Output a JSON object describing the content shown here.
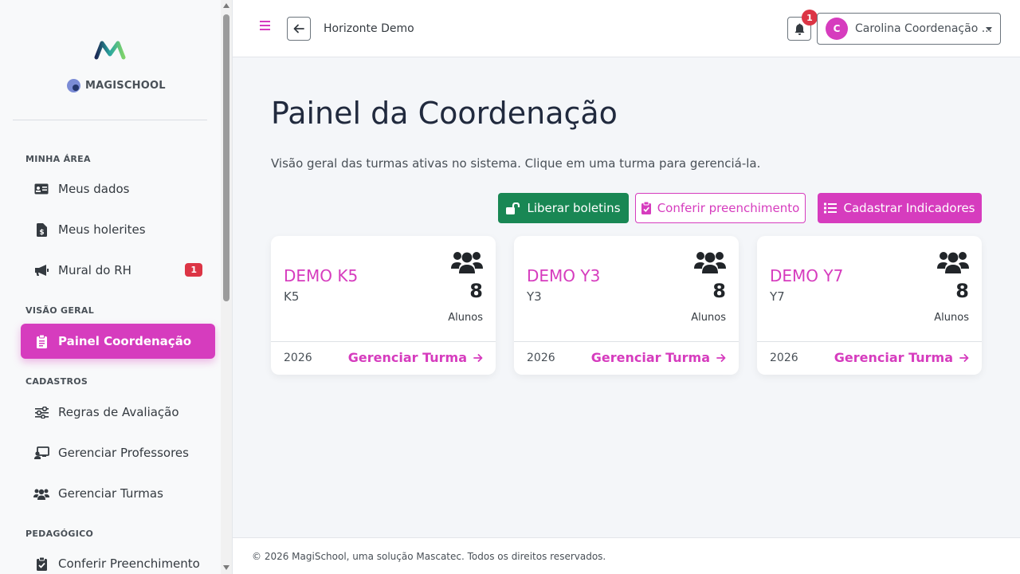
{
  "sidebar": {
    "brand": "MAGISCHOOL",
    "sections": {
      "minha_area": "MINHA ÁREA",
      "visao_geral": "VISÃO GERAL",
      "cadastros": "CADASTROS",
      "pedagogico": "PEDAGÓGICO"
    },
    "items": {
      "meus_dados": "Meus dados",
      "meus_holerites": "Meus holerites",
      "mural_rh": "Mural do RH",
      "mural_rh_badge": "1",
      "painel_coordenacao": "Painel Coordenação",
      "regras_avaliacao": "Regras de Avaliação",
      "gerenciar_professores": "Gerenciar Professores",
      "gerenciar_turmas": "Gerenciar Turmas",
      "conferir_preenchimento": "Conferir Preenchimento"
    }
  },
  "topbar": {
    "breadcrumb": "Horizonte Demo",
    "notifications_count": "1",
    "user_initial": "C",
    "user_name": "Carolina Coordenação ..."
  },
  "main": {
    "title": "Painel da Coordenação",
    "subtitle": "Visão geral das turmas ativas no sistema. Clique em uma turma para gerenciá-la.",
    "buttons": {
      "liberar": "Liberar boletins",
      "conferir": "Conferir preenchimento",
      "cadastrar": "Cadastrar Indicadores"
    },
    "cards": [
      {
        "name": "DEMO K5",
        "code": "K5",
        "count": "8",
        "count_label": "Alunos",
        "year": "2026",
        "link": "Gerenciar Turma"
      },
      {
        "name": "DEMO Y3",
        "code": "Y3",
        "count": "8",
        "count_label": "Alunos",
        "year": "2026",
        "link": "Gerenciar Turma"
      },
      {
        "name": "DEMO Y7",
        "code": "Y7",
        "count": "8",
        "count_label": "Alunos",
        "year": "2026",
        "link": "Gerenciar Turma"
      }
    ]
  },
  "footer": {
    "text": "© 2026 MagiSchool, uma solução Mascatec. Todos os direitos reservados."
  },
  "colors": {
    "accent": "#d63cbe",
    "success": "#198754",
    "danger": "#dc3545"
  }
}
